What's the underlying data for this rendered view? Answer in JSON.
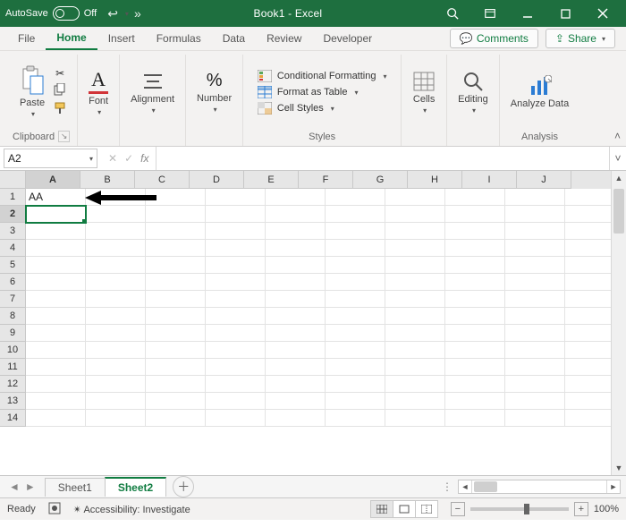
{
  "titlebar": {
    "autosave_label": "AutoSave",
    "autosave_state": "Off",
    "doc_title": "Book1 - Excel"
  },
  "tabs": {
    "file": "File",
    "home": "Home",
    "insert": "Insert",
    "formulas": "Formulas",
    "data": "Data",
    "review": "Review",
    "developer": "Developer",
    "comments": "Comments",
    "share": "Share"
  },
  "ribbon": {
    "clipboard": {
      "paste": "Paste",
      "group": "Clipboard"
    },
    "font": {
      "label": "Font",
      "group": "Font"
    },
    "alignment": {
      "label": "Alignment",
      "group": "Alignment"
    },
    "number": {
      "label": "Number",
      "group": "Number"
    },
    "styles": {
      "cond": "Conditional Formatting",
      "table": "Format as Table",
      "cellstyles": "Cell Styles",
      "group": "Styles"
    },
    "cells": {
      "label": "Cells",
      "group": "Cells"
    },
    "editing": {
      "label": "Editing",
      "group": "Editing"
    },
    "analysis": {
      "label": "Analyze Data",
      "group": "Analysis"
    }
  },
  "formula_bar": {
    "name_box": "A2",
    "fx": "fx",
    "formula": ""
  },
  "grid": {
    "columns": [
      "A",
      "B",
      "C",
      "D",
      "E",
      "F",
      "G",
      "H",
      "I",
      "J"
    ],
    "selected_col": "A",
    "rows": [
      "1",
      "2",
      "3",
      "4",
      "5",
      "6",
      "7",
      "8",
      "9",
      "10",
      "11",
      "12",
      "13",
      "14"
    ],
    "selected_row": "2",
    "selected_cell": "A2",
    "cells": {
      "A1": "AA"
    }
  },
  "sheet_tabs": {
    "tabs": [
      "Sheet1",
      "Sheet2"
    ],
    "active": "Sheet2"
  },
  "statusbar": {
    "state": "Ready",
    "accessibility": "Accessibility: Investigate",
    "zoom": "100%"
  }
}
